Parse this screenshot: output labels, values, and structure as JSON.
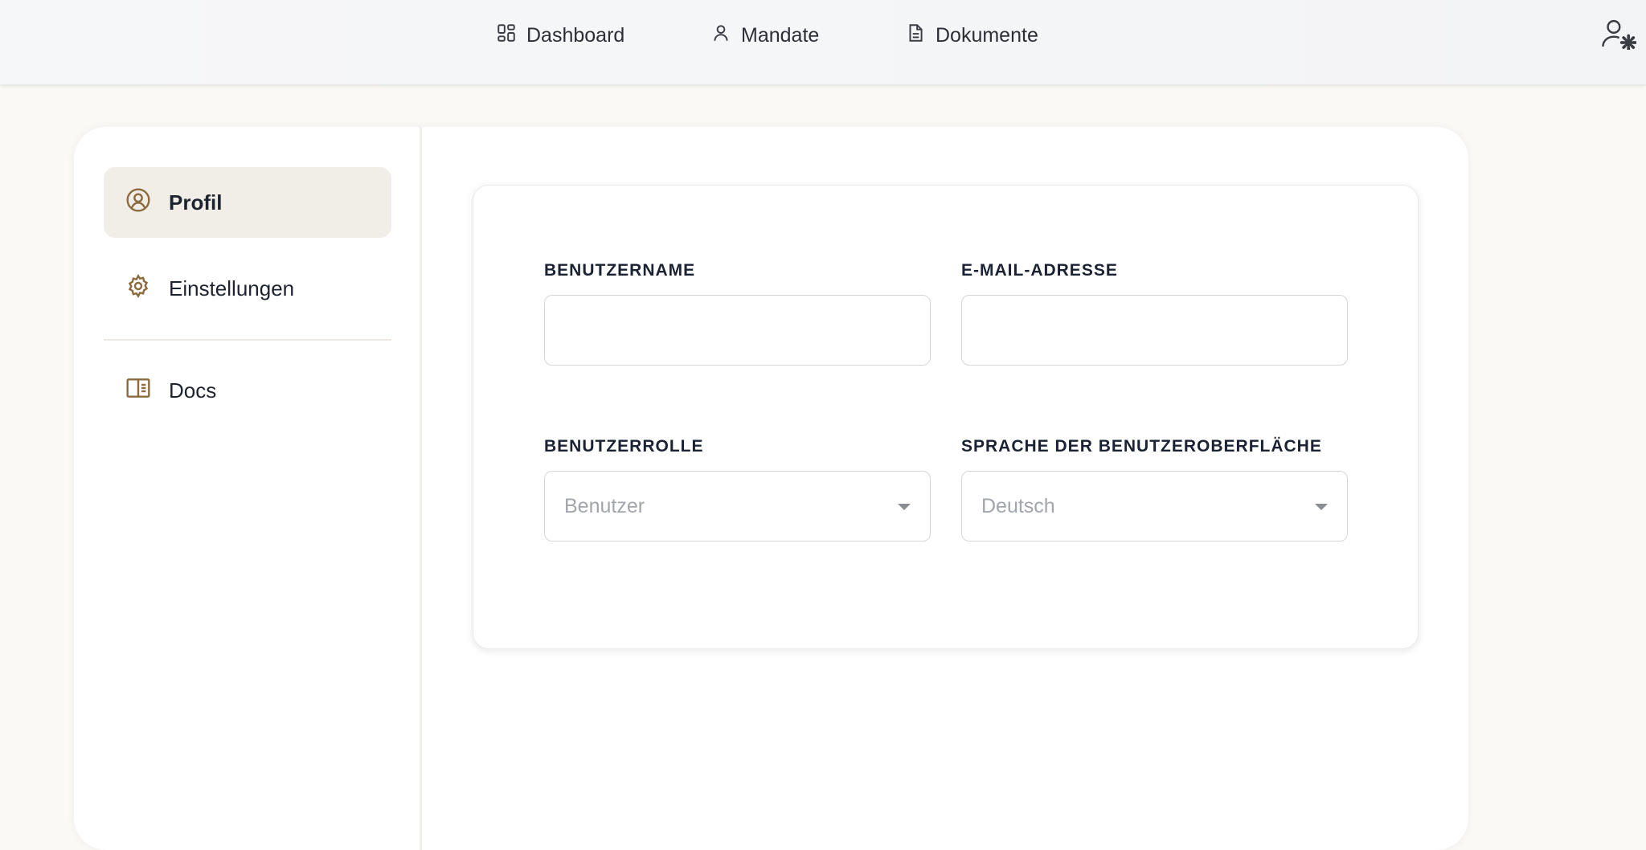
{
  "nav": {
    "items": [
      {
        "label": "Dashboard",
        "icon": "dashboard-grid-icon"
      },
      {
        "label": "Mandate",
        "icon": "user-icon"
      },
      {
        "label": "Dokumente",
        "icon": "document-icon"
      }
    ],
    "account_icon": "user-settings-icon"
  },
  "sidebar": {
    "items": [
      {
        "label": "Profil",
        "icon": "user-circle-icon",
        "active": true
      },
      {
        "label": "Einstellungen",
        "icon": "gear-icon",
        "active": false
      },
      {
        "label": "Docs",
        "icon": "book-icon",
        "active": false
      }
    ]
  },
  "form": {
    "username": {
      "label": "BENUTZERNAME",
      "value": ""
    },
    "email": {
      "label": "E-MAIL-ADRESSE",
      "value": ""
    },
    "role": {
      "label": "BENUTZERROLLE",
      "selected": "Benutzer"
    },
    "language": {
      "label": "SPRACHE DER BENUTZEROBERFLÄCHE",
      "selected": "Deutsch"
    }
  },
  "colors": {
    "accent": "#8b6a3e",
    "active_bg": "#f1eee7",
    "page_bg": "#fbf9f6"
  }
}
